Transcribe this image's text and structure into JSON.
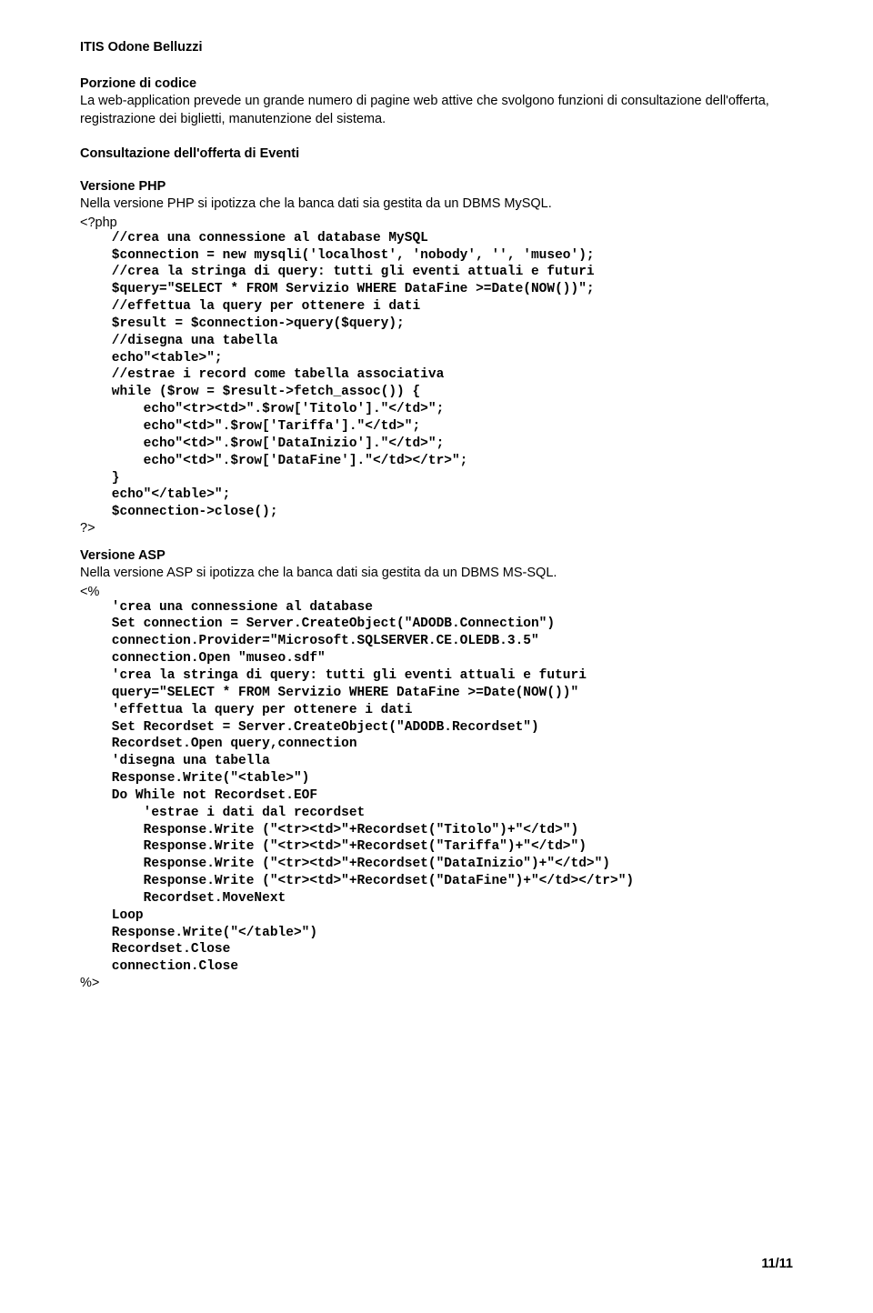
{
  "header": {
    "title": "ITIS Odone Belluzzi"
  },
  "section1": {
    "title": "Porzione di codice",
    "paragraph": "La web-application prevede un grande numero di pagine web attive che svolgono funzioni di consultazione dell'offerta, registrazione dei biglietti, manutenzione del sistema."
  },
  "section2": {
    "title": "Consultazione dell'offerta di Eventi"
  },
  "php": {
    "title": "Versione PHP",
    "desc": "Nella versione PHP si ipotizza che la banca dati sia gestita da un DBMS MySQL.",
    "open": "<?php",
    "code": "    //crea una connessione al database MySQL\n    $connection = new mysqli('localhost', 'nobody', '', 'museo');\n    //crea la stringa di query: tutti gli eventi attuali e futuri\n    $query=\"SELECT * FROM Servizio WHERE DataFine >=Date(NOW())\";\n    //effettua la query per ottenere i dati\n    $result = $connection->query($query);\n    //disegna una tabella\n    echo\"<table>\";\n    //estrae i record come tabella associativa\n    while ($row = $result->fetch_assoc()) {\n        echo\"<tr><td>\".$row['Titolo'].\"</td>\";\n        echo\"<td>\".$row['Tariffa'].\"</td>\";\n        echo\"<td>\".$row['DataInizio'].\"</td>\";\n        echo\"<td>\".$row['DataFine'].\"</td></tr>\";\n    }\n    echo\"</table>\";\n    $connection->close();",
    "close": "?>"
  },
  "asp": {
    "title": "Versione ASP",
    "desc": "Nella versione ASP si ipotizza che la banca dati sia gestita da un DBMS MS-SQL.",
    "open": "<%",
    "code": "    'crea una connessione al database\n    Set connection = Server.CreateObject(\"ADODB.Connection\")\n    connection.Provider=\"Microsoft.SQLSERVER.CE.OLEDB.3.5\"\n    connection.Open \"museo.sdf\"\n    'crea la stringa di query: tutti gli eventi attuali e futuri\n    query=\"SELECT * FROM Servizio WHERE DataFine >=Date(NOW())\"\n    'effettua la query per ottenere i dati\n    Set Recordset = Server.CreateObject(\"ADODB.Recordset\")\n    Recordset.Open query,connection\n    'disegna una tabella\n    Response.Write(\"<table>\")\n    Do While not Recordset.EOF\n        'estrae i dati dal recordset\n        Response.Write (\"<tr><td>\"+Recordset(\"Titolo\")+\"</td>\")\n        Response.Write (\"<tr><td>\"+Recordset(\"Tariffa\")+\"</td>\")\n        Response.Write (\"<tr><td>\"+Recordset(\"DataInizio\")+\"</td>\")\n        Response.Write (\"<tr><td>\"+Recordset(\"DataFine\")+\"</td></tr>\")\n        Recordset.MoveNext\n    Loop\n    Response.Write(\"</table>\")\n    Recordset.Close\n    connection.Close",
    "close": "%>"
  },
  "footer": {
    "page": "11/11"
  }
}
